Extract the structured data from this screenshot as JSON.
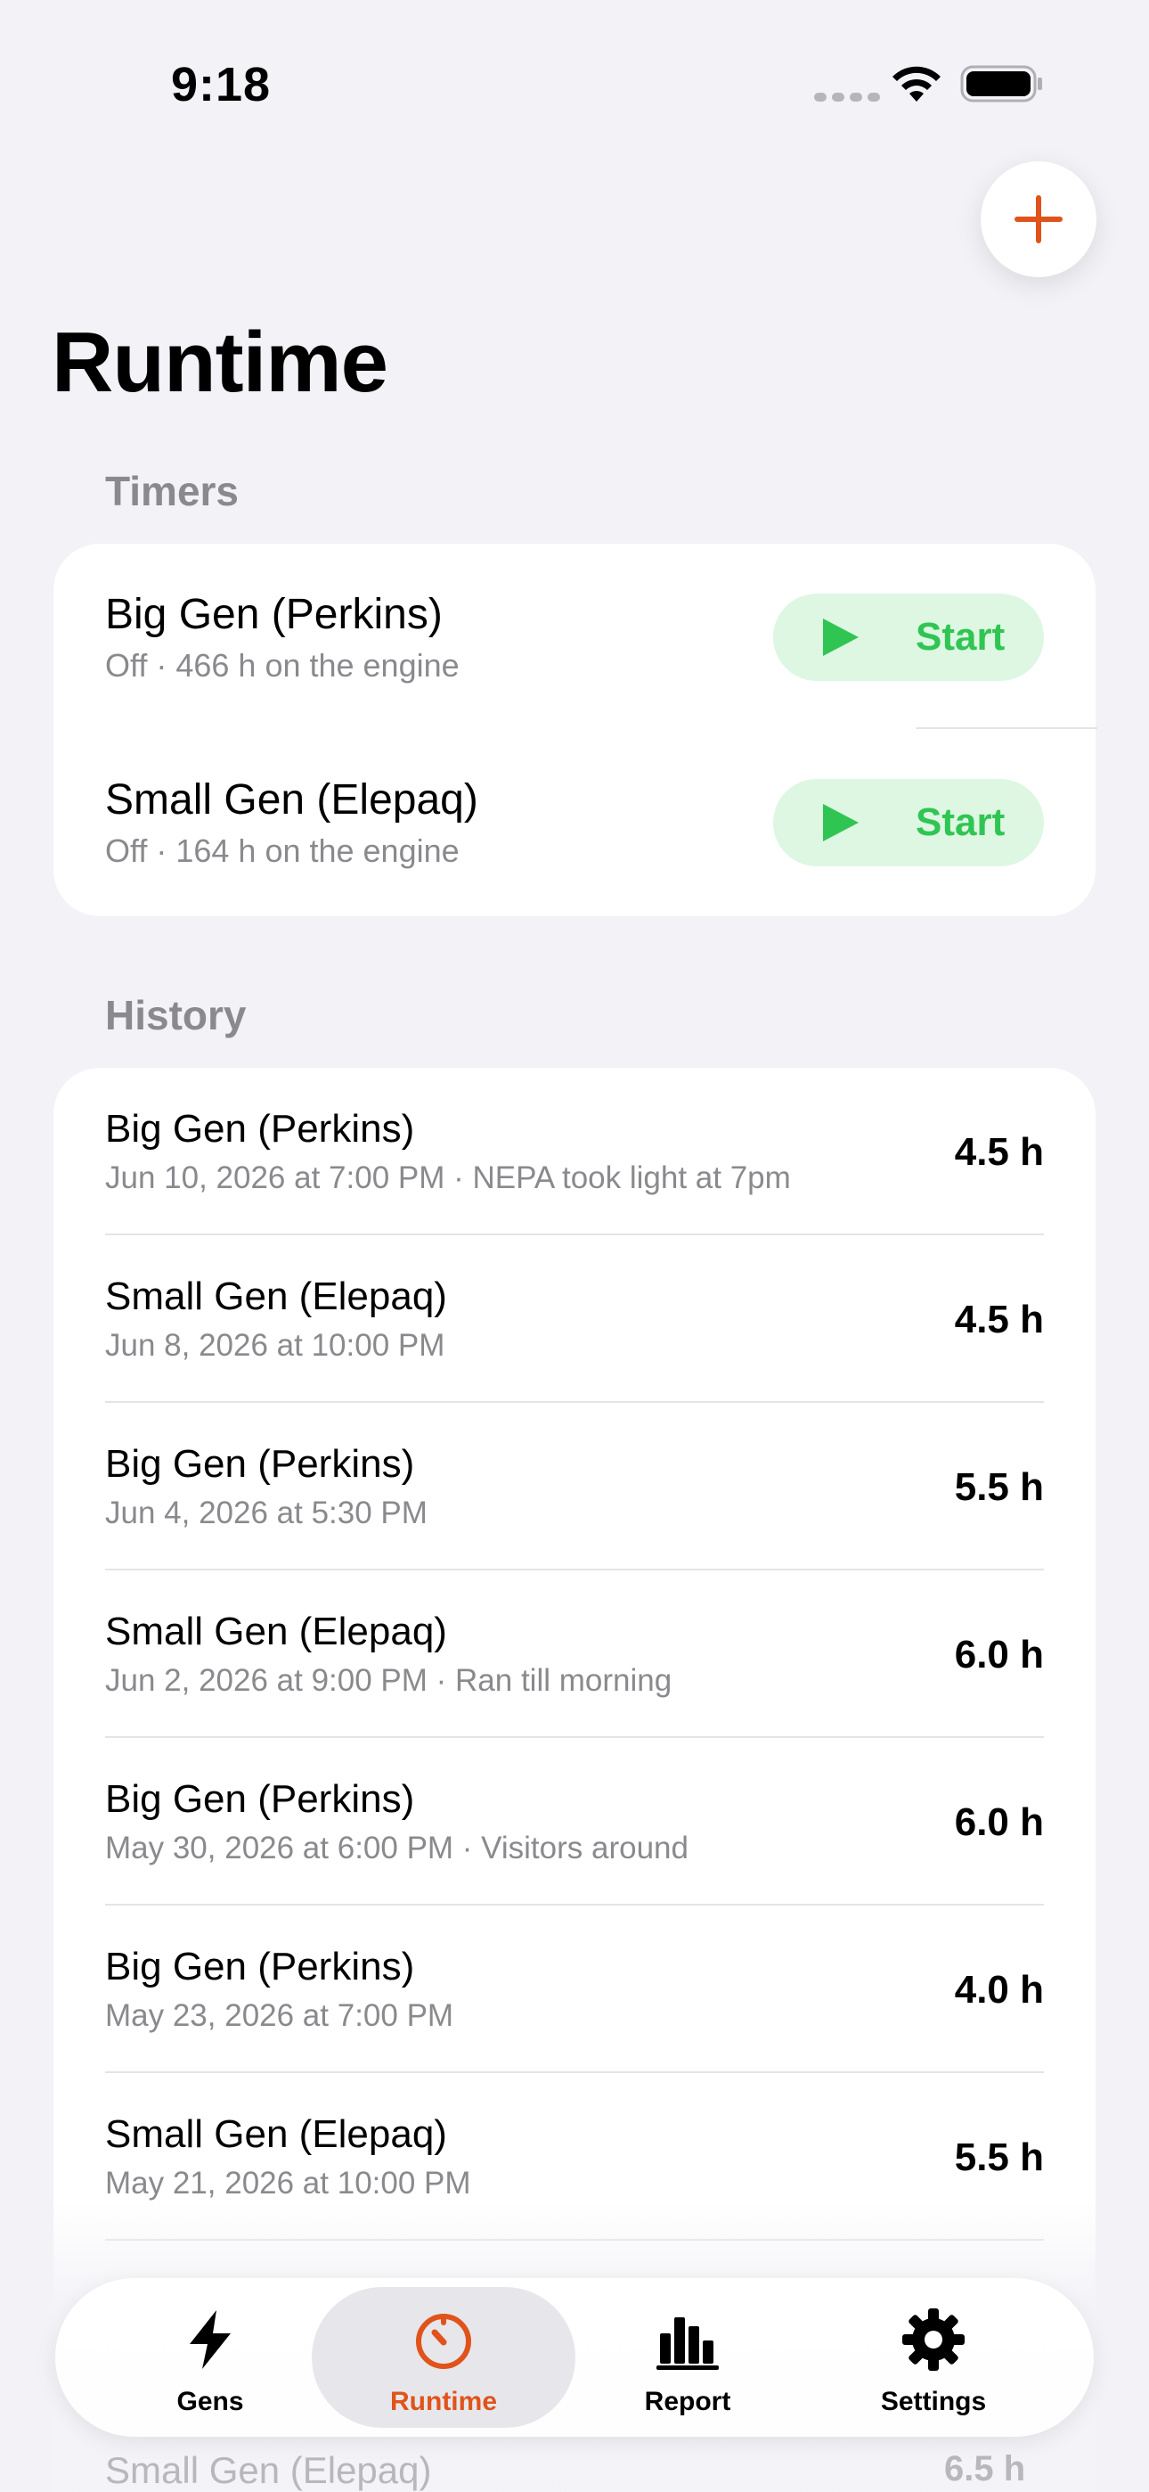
{
  "status": {
    "time": "9:18"
  },
  "colors": {
    "accent": "#E0531B",
    "start_green": "#30C552",
    "start_bg": "#DDF7E3"
  },
  "page": {
    "title": "Runtime"
  },
  "timers": {
    "header": "Timers",
    "items": [
      {
        "name": "Big Gen (Perkins)",
        "status": "Off · 466 h on the engine",
        "button": "Start"
      },
      {
        "name": "Small Gen (Elepaq)",
        "status": "Off · 164 h on the engine",
        "button": "Start"
      }
    ]
  },
  "history": {
    "header": "History",
    "items": [
      {
        "name": "Big Gen (Perkins)",
        "detail": "Jun 10, 2026 at 7:00 PM · NEPA took light at 7pm",
        "duration": "4.5 h"
      },
      {
        "name": "Small Gen (Elepaq)",
        "detail": "Jun 8, 2026 at 10:00 PM",
        "duration": "4.5 h"
      },
      {
        "name": "Big Gen (Perkins)",
        "detail": "Jun 4, 2026 at 5:30 PM",
        "duration": "5.5 h"
      },
      {
        "name": "Small Gen (Elepaq)",
        "detail": "Jun 2, 2026 at 9:00 PM · Ran till morning",
        "duration": "6.0 h"
      },
      {
        "name": "Big Gen (Perkins)",
        "detail": "May 30, 2026 at 6:00 PM · Visitors around",
        "duration": "6.0 h"
      },
      {
        "name": "Big Gen (Perkins)",
        "detail": "May 23, 2026 at 7:00 PM",
        "duration": "4.0 h"
      },
      {
        "name": "Small Gen (Elepaq)",
        "detail": "May 21, 2026 at 10:00 PM",
        "duration": "5.5 h"
      }
    ],
    "peek_name": "Small Gen (Elepaq)",
    "peek_duration": "6.5 h"
  },
  "tabs": [
    {
      "label": "Gens",
      "icon": "bolt-icon"
    },
    {
      "label": "Runtime",
      "icon": "timer-icon",
      "active": true
    },
    {
      "label": "Report",
      "icon": "bar-chart-icon"
    },
    {
      "label": "Settings",
      "icon": "gear-icon"
    }
  ]
}
